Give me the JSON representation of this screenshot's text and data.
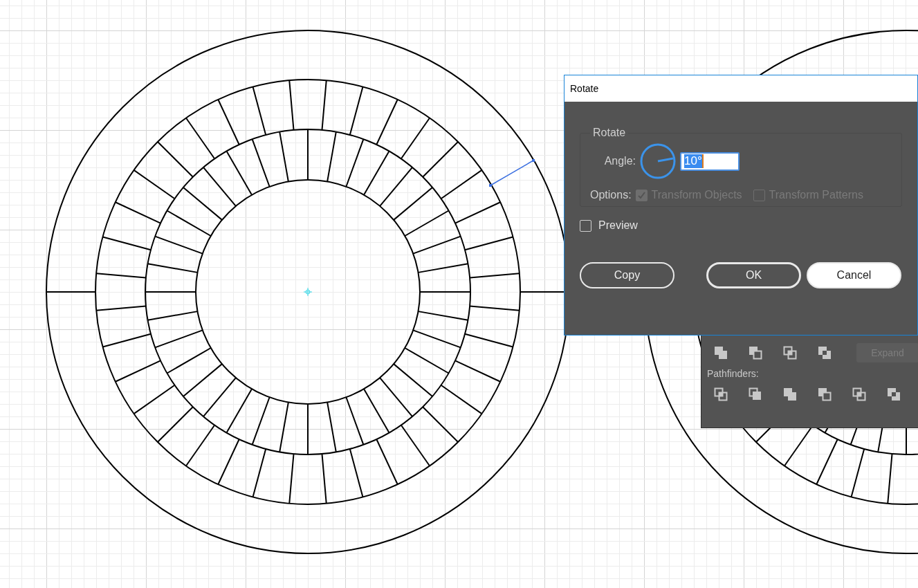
{
  "dialog": {
    "title": "Rotate",
    "group_label": "Rotate",
    "angle": {
      "label": "Angle:",
      "value": "10°"
    },
    "options": {
      "label": "Options:",
      "items": [
        {
          "label": "Transform Objects",
          "checked": true,
          "disabled": true
        },
        {
          "label": "Transform Patterns",
          "checked": false,
          "disabled": true
        }
      ]
    },
    "preview": {
      "label": "Preview",
      "checked": false
    },
    "buttons": [
      {
        "label": "Copy",
        "selected": false
      },
      {
        "label": "OK",
        "selected": false
      },
      {
        "label": "Cancel",
        "selected": true
      }
    ]
  },
  "pathfinder_panel": {
    "expand_button": {
      "label": "Expand",
      "disabled": true
    },
    "pathfinders_label": "Pathfinders:"
  }
}
